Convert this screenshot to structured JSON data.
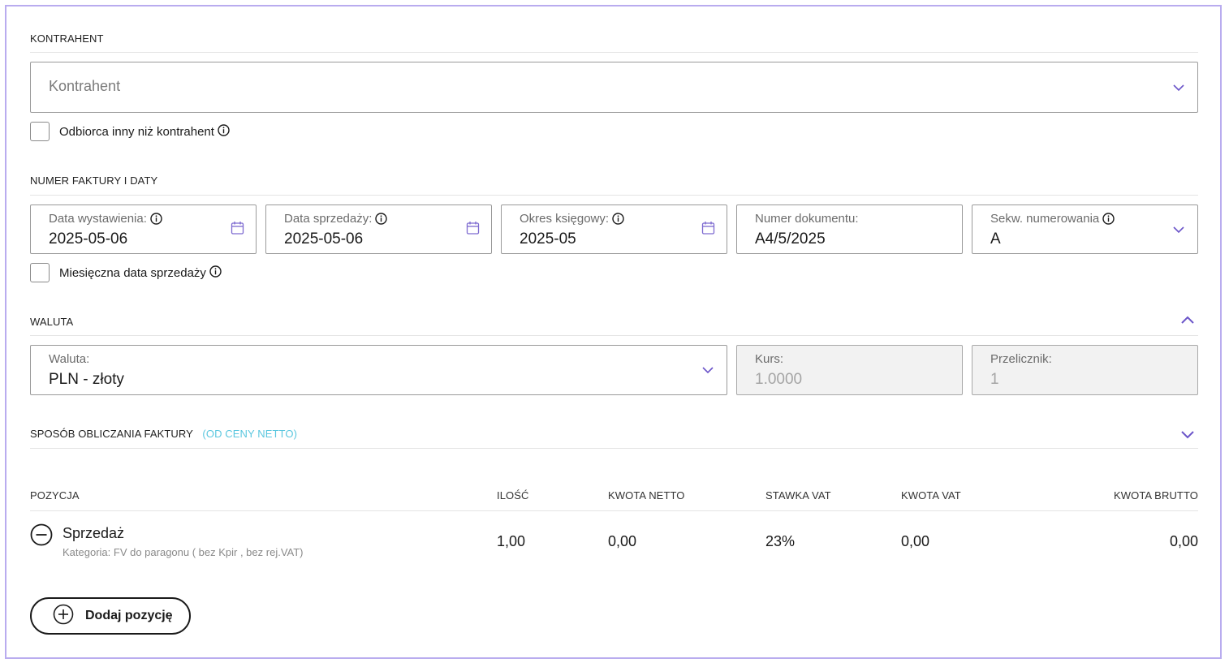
{
  "sections": {
    "kontrahent": "KONTRAHENT",
    "numer": "NUMER FAKTURY I DATY",
    "waluta": "WALUTA",
    "sposob": "SPOSÓB OBLICZANIA FAKTURY",
    "sposob_tag": "(OD CENY NETTO)"
  },
  "kontrahent": {
    "placeholder": "Kontrahent",
    "checkbox_label": "Odbiorca inny niż kontrahent"
  },
  "dates": {
    "data_wystawienia": {
      "label": "Data wystawienia:",
      "value": "2025-05-06"
    },
    "data_sprzedazy": {
      "label": "Data sprzedaży:",
      "value": "2025-05-06"
    },
    "okres": {
      "label": "Okres księgowy:",
      "value": "2025-05"
    },
    "numer": {
      "label": "Numer dokumentu:",
      "value": "A4/5/2025"
    },
    "sekw": {
      "label": "Sekw. numerowania",
      "value": "A"
    },
    "monthly_checkbox_label": "Miesięczna data sprzedaży"
  },
  "currency": {
    "waluta": {
      "label": "Waluta:",
      "value": "PLN - złoty"
    },
    "kurs": {
      "label": "Kurs:",
      "value": "1.0000"
    },
    "przelicznik": {
      "label": "Przelicznik:",
      "value": "1"
    }
  },
  "table": {
    "headers": {
      "pozycja": "POZYCJA",
      "ilosc": "ILOŚĆ",
      "netto": "KWOTA NETTO",
      "stawka": "STAWKA VAT",
      "vat": "KWOTA VAT",
      "brutto": "KWOTA BRUTTO"
    },
    "rows": [
      {
        "name": "Sprzedaż",
        "category": "Kategoria: FV do paragonu ( bez Kpir , bez rej.VAT)",
        "ilosc": "1,00",
        "netto": "0,00",
        "stawka": "23%",
        "vat": "0,00",
        "brutto": "0,00"
      }
    ]
  },
  "add_button_label": "Dodaj pozycję",
  "colors": {
    "accent": "#6b55c9",
    "link": "#5bc7df",
    "frame": "#b9acef"
  },
  "icons": {
    "info": "info-icon",
    "calendar": "calendar-icon",
    "chevron_down": "chevron-down-icon",
    "chevron_up": "chevron-up-icon",
    "remove": "minus-circle-icon",
    "add": "plus-circle-icon"
  }
}
